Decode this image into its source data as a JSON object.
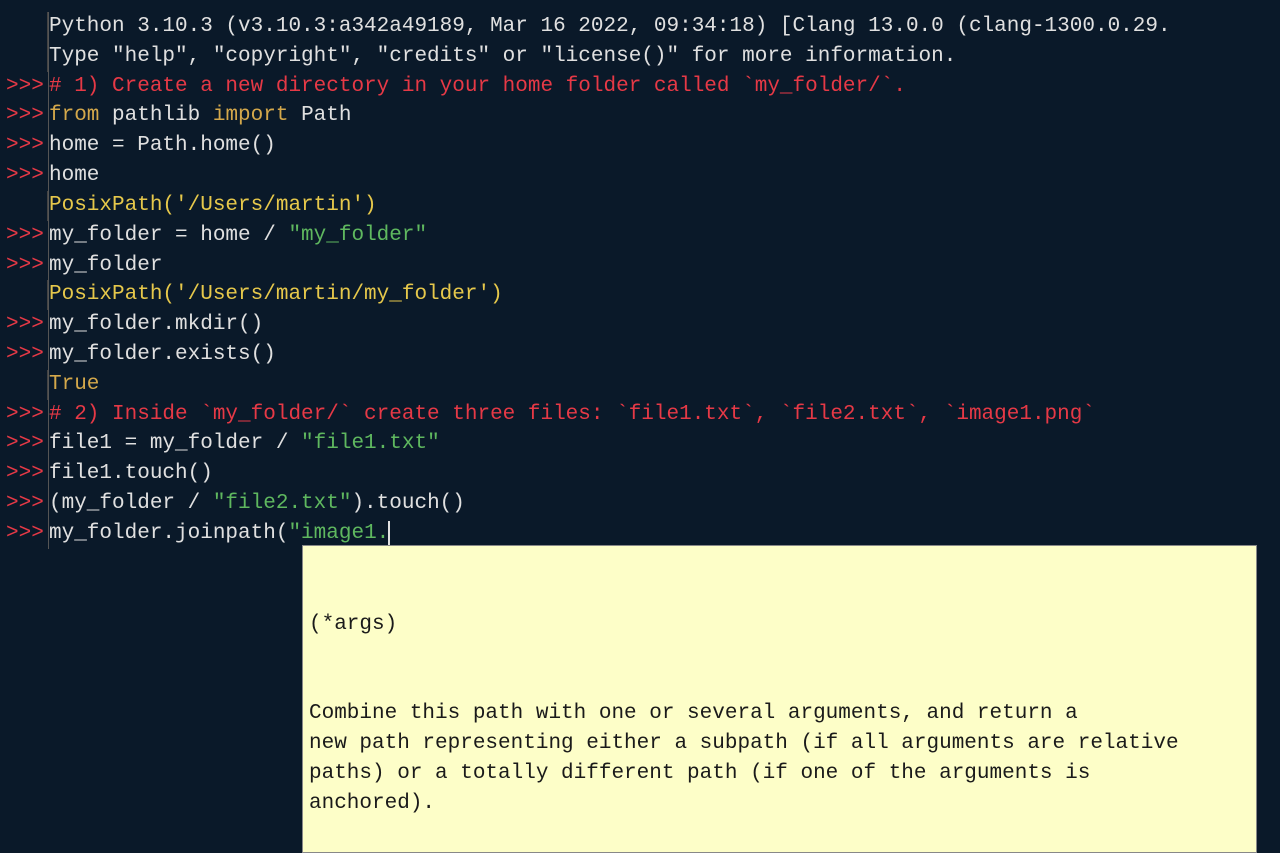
{
  "header": {
    "line1": "Python 3.10.3 (v3.10.3:a342a49189, Mar 16 2022, 09:34:18) [Clang 13.0.0 (clang-1300.0.29.",
    "line2": "Type \"help\", \"copyright\", \"credits\" or \"license()\" for more information."
  },
  "prompt": ">>> ",
  "lines": {
    "l1_comment": "# 1) Create a new directory in your home folder called `my_folder/`.",
    "l2_from": "from",
    "l2_pathlib": " pathlib ",
    "l2_import": "import",
    "l2_path": " Path",
    "l3": "home = Path.home()",
    "l4": "home",
    "l5_result": "PosixPath('/Users/martin')",
    "l6_pre": "my_folder = home / ",
    "l6_str": "\"my_folder\"",
    "l7": "my_folder",
    "l8_result": "PosixPath('/Users/martin/my_folder')",
    "l9": "my_folder.mkdir()",
    "l10": "my_folder.exists()",
    "l11_result": "True",
    "l12_comment": "# 2) Inside `my_folder/` create three files: `file1.txt`, `file2.txt`, `image1.png`",
    "l13_pre": "file1 = my_folder / ",
    "l13_str": "\"file1.txt\"",
    "l14": "file1.touch()",
    "l15_pre": "(my_folder / ",
    "l15_str": "\"file2.txt\"",
    "l15_post": ").touch()",
    "l16_pre": "my_folder.joinpath(",
    "l16_str": "\"image1."
  },
  "tooltip": {
    "sig": "(*args)",
    "doc": "Combine this path with one or several arguments, and return a\nnew path representing either a subpath (if all arguments are relative\npaths) or a totally different path (if one of the arguments is\nanchored)."
  }
}
